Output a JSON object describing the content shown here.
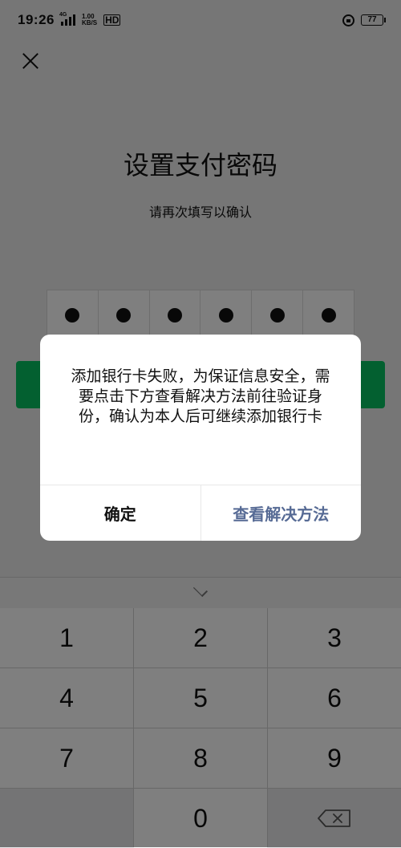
{
  "status_bar": {
    "time": "19:26",
    "network_type": "4G",
    "net_speed_value": "1.00",
    "net_speed_unit": "KB/S",
    "hd": "HD",
    "battery": "77"
  },
  "page": {
    "title": "设置支付密码",
    "subtitle": "请再次填写以确认",
    "pin_length": 6,
    "pin_filled": 6
  },
  "dialog": {
    "message": "添加银行卡失败，为保证信息安全，需要点击下方查看解决方法前往验证身份，确认为本人后可继续添加银行卡",
    "ok_label": "确定",
    "solution_label": "查看解决方法"
  },
  "keyboard": {
    "keys": [
      "1",
      "2",
      "3",
      "4",
      "5",
      "6",
      "7",
      "8",
      "9",
      "",
      "0",
      "backspace-icon"
    ]
  },
  "colors": {
    "accent_green": "#07c160",
    "link_blue": "#576b95"
  }
}
